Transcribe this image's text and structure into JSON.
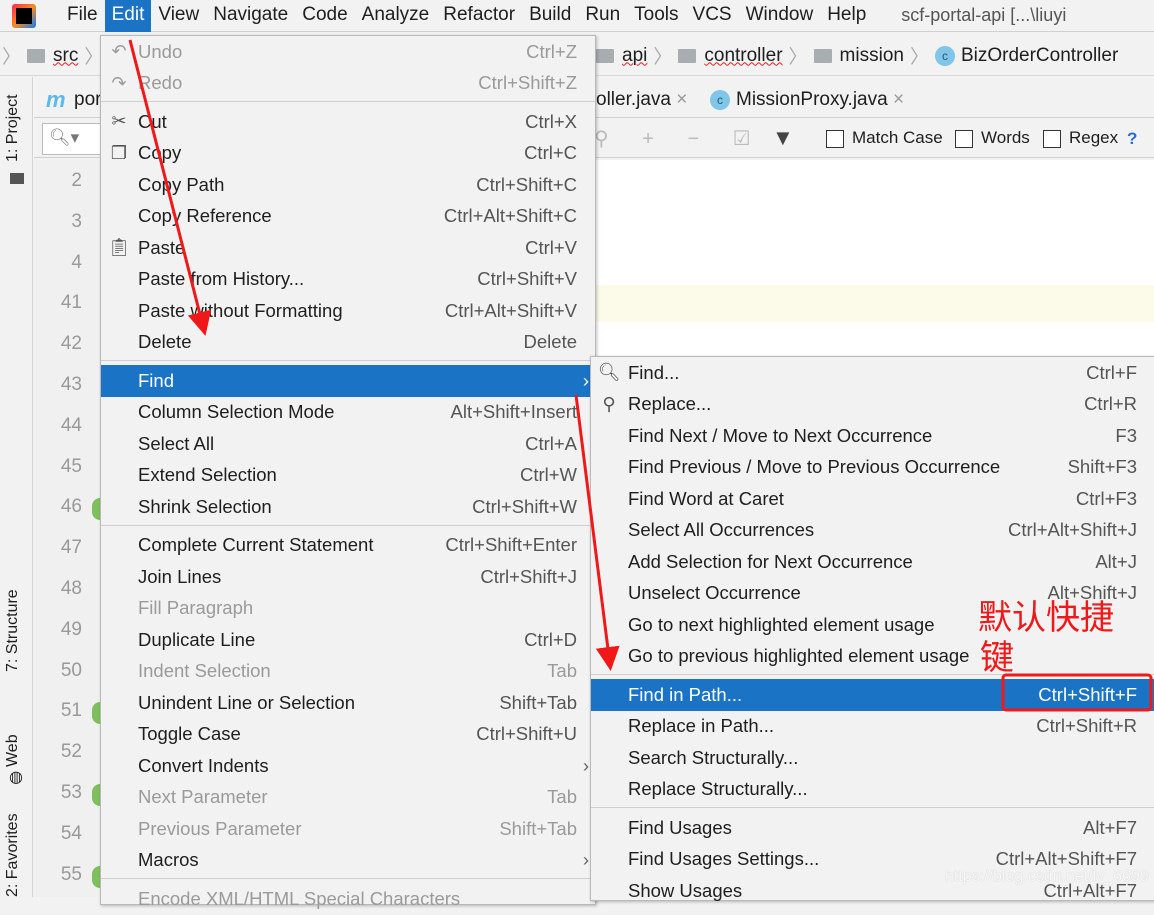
{
  "menubar": {
    "items": [
      "File",
      "Edit",
      "View",
      "Navigate",
      "Code",
      "Analyze",
      "Refactor",
      "Build",
      "Run",
      "Tools",
      "VCS",
      "Window",
      "Help"
    ],
    "active": "Edit",
    "window_title": "scf-portal-api [...\\liuyi"
  },
  "breadcrumb": [
    "src",
    "api",
    "controller",
    "mission",
    "BizOrderController"
  ],
  "tool_strip": [
    "1: Project",
    "7: Structure",
    "Web",
    "2: Favorites"
  ],
  "tabs": [
    {
      "label": "por"
    },
    {
      "label": "oller.java"
    },
    {
      "label": "MissionProxy.java"
    }
  ],
  "findbar": {
    "match_case": "Match Case",
    "words": "Words",
    "regex": "Regex",
    "help": "?"
  },
  "gutter": [
    "2",
    "3",
    "4",
    "41",
    "42",
    "43",
    "44",
    "45",
    "46",
    "47",
    "48",
    "49",
    "50",
    "51",
    "52",
    "53",
    "54",
    "55"
  ],
  "edit_menu": [
    {
      "label": "Undo",
      "shortcut": "Ctrl+Z",
      "disabled": true,
      "icon": "undo-icon"
    },
    {
      "label": "Redo",
      "shortcut": "Ctrl+Shift+Z",
      "disabled": true,
      "icon": "redo-icon"
    },
    {
      "sep": true
    },
    {
      "label": "Cut",
      "shortcut": "Ctrl+X",
      "icon": "scissors-icon"
    },
    {
      "label": "Copy",
      "shortcut": "Ctrl+C",
      "icon": "copy-icon"
    },
    {
      "label": "Copy Path",
      "shortcut": "Ctrl+Shift+C"
    },
    {
      "label": "Copy Reference",
      "shortcut": "Ctrl+Alt+Shift+C"
    },
    {
      "label": "Paste",
      "shortcut": "Ctrl+V",
      "icon": "clipboard-icon"
    },
    {
      "label": "Paste from History...",
      "shortcut": "Ctrl+Shift+V"
    },
    {
      "label": "Paste without Formatting",
      "shortcut": "Ctrl+Alt+Shift+V"
    },
    {
      "label": "Delete",
      "shortcut": "Delete"
    },
    {
      "sep": true
    },
    {
      "label": "Find",
      "submenu": true,
      "highlighted": true
    },
    {
      "label": "Column Selection Mode",
      "shortcut": "Alt+Shift+Insert"
    },
    {
      "label": "Select All",
      "shortcut": "Ctrl+A"
    },
    {
      "label": "Extend Selection",
      "shortcut": "Ctrl+W"
    },
    {
      "label": "Shrink Selection",
      "shortcut": "Ctrl+Shift+W"
    },
    {
      "sep": true
    },
    {
      "label": "Complete Current Statement",
      "shortcut": "Ctrl+Shift+Enter"
    },
    {
      "label": "Join Lines",
      "shortcut": "Ctrl+Shift+J"
    },
    {
      "label": "Fill Paragraph",
      "disabled": true
    },
    {
      "label": "Duplicate Line",
      "shortcut": "Ctrl+D"
    },
    {
      "label": "Indent Selection",
      "shortcut": "Tab",
      "disabled": true
    },
    {
      "label": "Unindent Line or Selection",
      "shortcut": "Shift+Tab"
    },
    {
      "label": "Toggle Case",
      "shortcut": "Ctrl+Shift+U"
    },
    {
      "label": "Convert Indents",
      "submenu": true
    },
    {
      "label": "Next Parameter",
      "shortcut": "Tab",
      "disabled": true
    },
    {
      "label": "Previous Parameter",
      "shortcut": "Shift+Tab",
      "disabled": true
    },
    {
      "label": "Macros",
      "submenu": true
    },
    {
      "sep": true
    },
    {
      "label": "Encode XML/HTML Special Characters",
      "disabled": true
    }
  ],
  "find_menu": [
    {
      "label": "Find...",
      "shortcut": "Ctrl+F",
      "icon": "search-icon"
    },
    {
      "label": "Replace...",
      "shortcut": "Ctrl+R",
      "icon": "replace-icon"
    },
    {
      "label": "Find Next / Move to Next Occurrence",
      "shortcut": "F3"
    },
    {
      "label": "Find Previous / Move to Previous Occurrence",
      "shortcut": "Shift+F3"
    },
    {
      "label": "Find Word at Caret",
      "shortcut": "Ctrl+F3"
    },
    {
      "label": "Select All Occurrences",
      "shortcut": "Ctrl+Alt+Shift+J"
    },
    {
      "label": "Add Selection for Next Occurrence",
      "shortcut": "Alt+J"
    },
    {
      "label": "Unselect Occurrence",
      "shortcut": "Alt+Shift+J"
    },
    {
      "label": "Go to next highlighted element usage"
    },
    {
      "label": "Go to previous highlighted element usage"
    },
    {
      "sep": true
    },
    {
      "label": "Find in Path...",
      "shortcut": "Ctrl+Shift+F",
      "highlighted": true
    },
    {
      "label": "Replace in Path...",
      "shortcut": "Ctrl+Shift+R"
    },
    {
      "label": "Search Structurally..."
    },
    {
      "label": "Replace Structurally..."
    },
    {
      "sep": true
    },
    {
      "label": "Find Usages",
      "shortcut": "Alt+F7"
    },
    {
      "label": "Find Usages Settings...",
      "shortcut": "Ctrl+Alt+Shift+F7"
    },
    {
      "label": "Show Usages",
      "shortcut": "Ctrl+Alt+F7"
    }
  ],
  "annotation": {
    "line1": "默认快捷",
    "line2": "键"
  },
  "watermark": "https://blog.csdn.net/lv_6699",
  "colors": {
    "highlight": "#1a73c4",
    "annotation": "#f01818",
    "current_line": "#fcfae8"
  }
}
